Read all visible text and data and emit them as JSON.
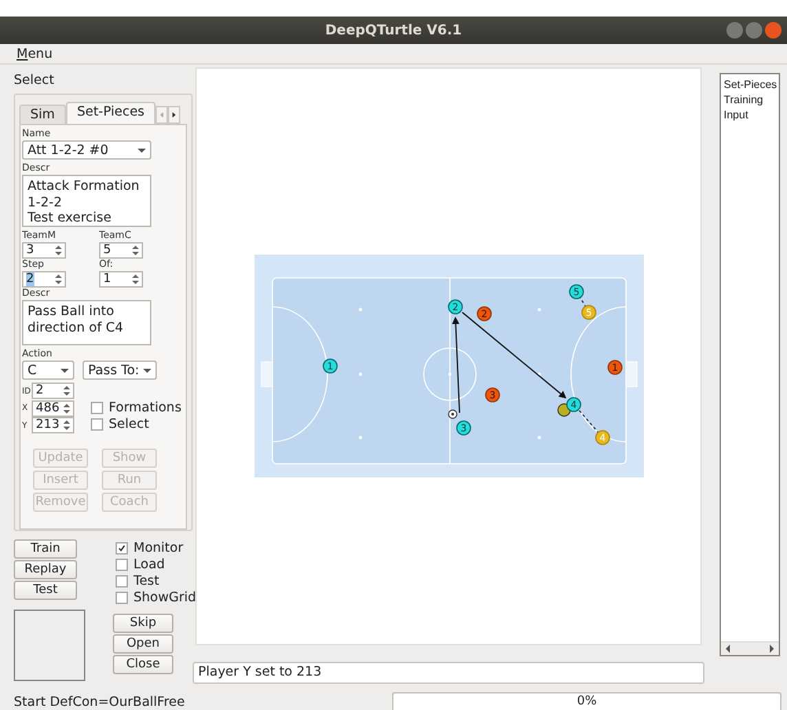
{
  "window": {
    "title": "DeepQTurtle V6.1"
  },
  "menu": [
    "Menu"
  ],
  "select_label": "Select",
  "tabs": [
    {
      "label": "Sim",
      "selected": false
    },
    {
      "label": "Set-Pieces",
      "selected": true
    }
  ],
  "name": {
    "label": "Name",
    "value": "Att 1-2-2 #0"
  },
  "descr": {
    "label": "Descr",
    "value": "Attack Formation\n1-2-2\nTest exercise"
  },
  "team_m": {
    "label": "TeamM",
    "value": "3",
    "selected": false
  },
  "team_c": {
    "label": "TeamC",
    "value": "5",
    "selected": false
  },
  "step": {
    "label": "Step",
    "value": "2",
    "selected": true
  },
  "of": {
    "label": "Of:",
    "value": "1",
    "selected": false
  },
  "step_descr": {
    "label": "Descr",
    "value": "Pass Ball into direction of C4"
  },
  "action": {
    "label": "Action",
    "combos": [
      "C",
      "Pass To:"
    ]
  },
  "coords": [
    {
      "label": "ID",
      "value": "2"
    },
    {
      "label": "X",
      "value": "486"
    },
    {
      "label": "Y",
      "value": "213"
    }
  ],
  "flags": [
    {
      "label": "Formations",
      "checked": false
    },
    {
      "label": "Select",
      "checked": false
    }
  ],
  "set_buttons": [
    {
      "label": "Update",
      "disabled": true
    },
    {
      "label": "Show",
      "disabled": true
    },
    {
      "label": "Insert",
      "disabled": true
    },
    {
      "label": "Run",
      "disabled": true
    },
    {
      "label": "Remove",
      "disabled": true
    },
    {
      "label": "Coach",
      "disabled": true
    }
  ],
  "run_buttons": [
    "Train",
    "Replay",
    "Test"
  ],
  "options": [
    {
      "label": "Monitor",
      "checked": true
    },
    {
      "label": "Load",
      "checked": false
    },
    {
      "label": "Test",
      "checked": false
    },
    {
      "label": "ShowGrid",
      "checked": false
    }
  ],
  "file_buttons": [
    "Skip",
    "Open",
    "Close"
  ],
  "players": [
    {
      "kind": "M",
      "label": "1"
    },
    {
      "kind": "M",
      "label": "2"
    },
    {
      "kind": "M",
      "label": "3"
    },
    {
      "kind": "M",
      "label": "4"
    },
    {
      "kind": "M",
      "label": "5"
    },
    {
      "kind": "C",
      "label": "2"
    },
    {
      "kind": "C",
      "label": "1"
    },
    {
      "kind": "C",
      "label": "3"
    },
    {
      "kind": "target",
      "label": "5"
    },
    {
      "kind": "target",
      "label": "4"
    }
  ],
  "modes": [
    "Set-Pieces",
    "Training",
    "Input"
  ],
  "status": "Player Y set to 213",
  "message": "Start DefCon=OurBallFree",
  "progress": {
    "level": 0,
    "text": "0%"
  }
}
